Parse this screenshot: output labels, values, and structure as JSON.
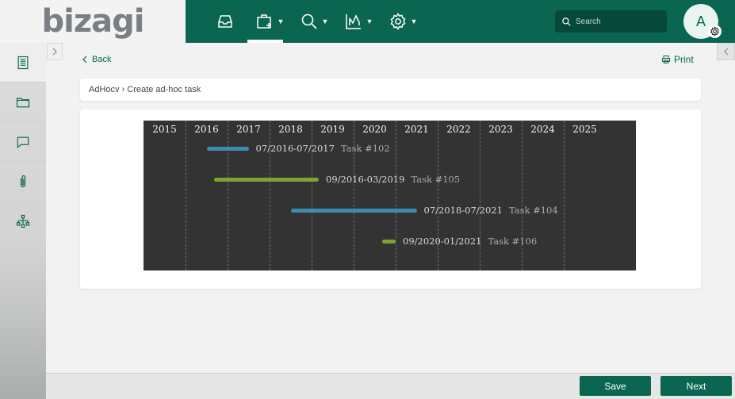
{
  "app": {
    "logo": "bizagi"
  },
  "header": {
    "nav": [
      {
        "name": "inbox-icon",
        "has_menu": false
      },
      {
        "name": "new-case-icon",
        "has_menu": true,
        "active": true
      },
      {
        "name": "search-icon",
        "has_menu": true
      },
      {
        "name": "analytics-icon",
        "has_menu": true
      },
      {
        "name": "settings-icon",
        "has_menu": true
      }
    ],
    "search": {
      "placeholder": "Search",
      "value": ""
    },
    "avatar": {
      "initial": "A"
    }
  },
  "sidebar": {
    "items": [
      {
        "name": "case-details-icon",
        "active": true
      },
      {
        "name": "folder-icon"
      },
      {
        "name": "comments-icon"
      },
      {
        "name": "attachment-icon"
      },
      {
        "name": "process-map-icon"
      }
    ]
  },
  "page": {
    "back_label": "Back",
    "print_label": "Print",
    "breadcrumb": "AdHocv › Create ad-hoc task"
  },
  "chart_data": {
    "type": "gantt",
    "x_axis_years": [
      "2015",
      "2016",
      "2017",
      "2018",
      "2019",
      "2020",
      "2021",
      "2022",
      "2023",
      "2024",
      "2025"
    ],
    "xlim": [
      2015,
      2026
    ],
    "grid": "dashed vertical",
    "colors": {
      "background": "#333333",
      "blue": "#3b8cae",
      "green": "#80a233"
    },
    "tasks": [
      {
        "task": "Task #102",
        "range_label": "07/2016-07/2017",
        "start": 2016.5,
        "end": 2017.5,
        "color": "#3b8cae"
      },
      {
        "task": "Task #105",
        "range_label": "09/2016-03/2019",
        "start": 2016.67,
        "end": 2019.17,
        "color": "#80a233"
      },
      {
        "task": "Task #104",
        "range_label": "07/2018-07/2021",
        "start": 2018.5,
        "end": 2021.5,
        "color": "#3b8cae"
      },
      {
        "task": "Task #106",
        "range_label": "09/2020-01/2021",
        "start": 2020.67,
        "end": 2021.0,
        "color": "#80a233"
      }
    ]
  },
  "actions": {
    "save_label": "Save",
    "next_label": "Next"
  }
}
